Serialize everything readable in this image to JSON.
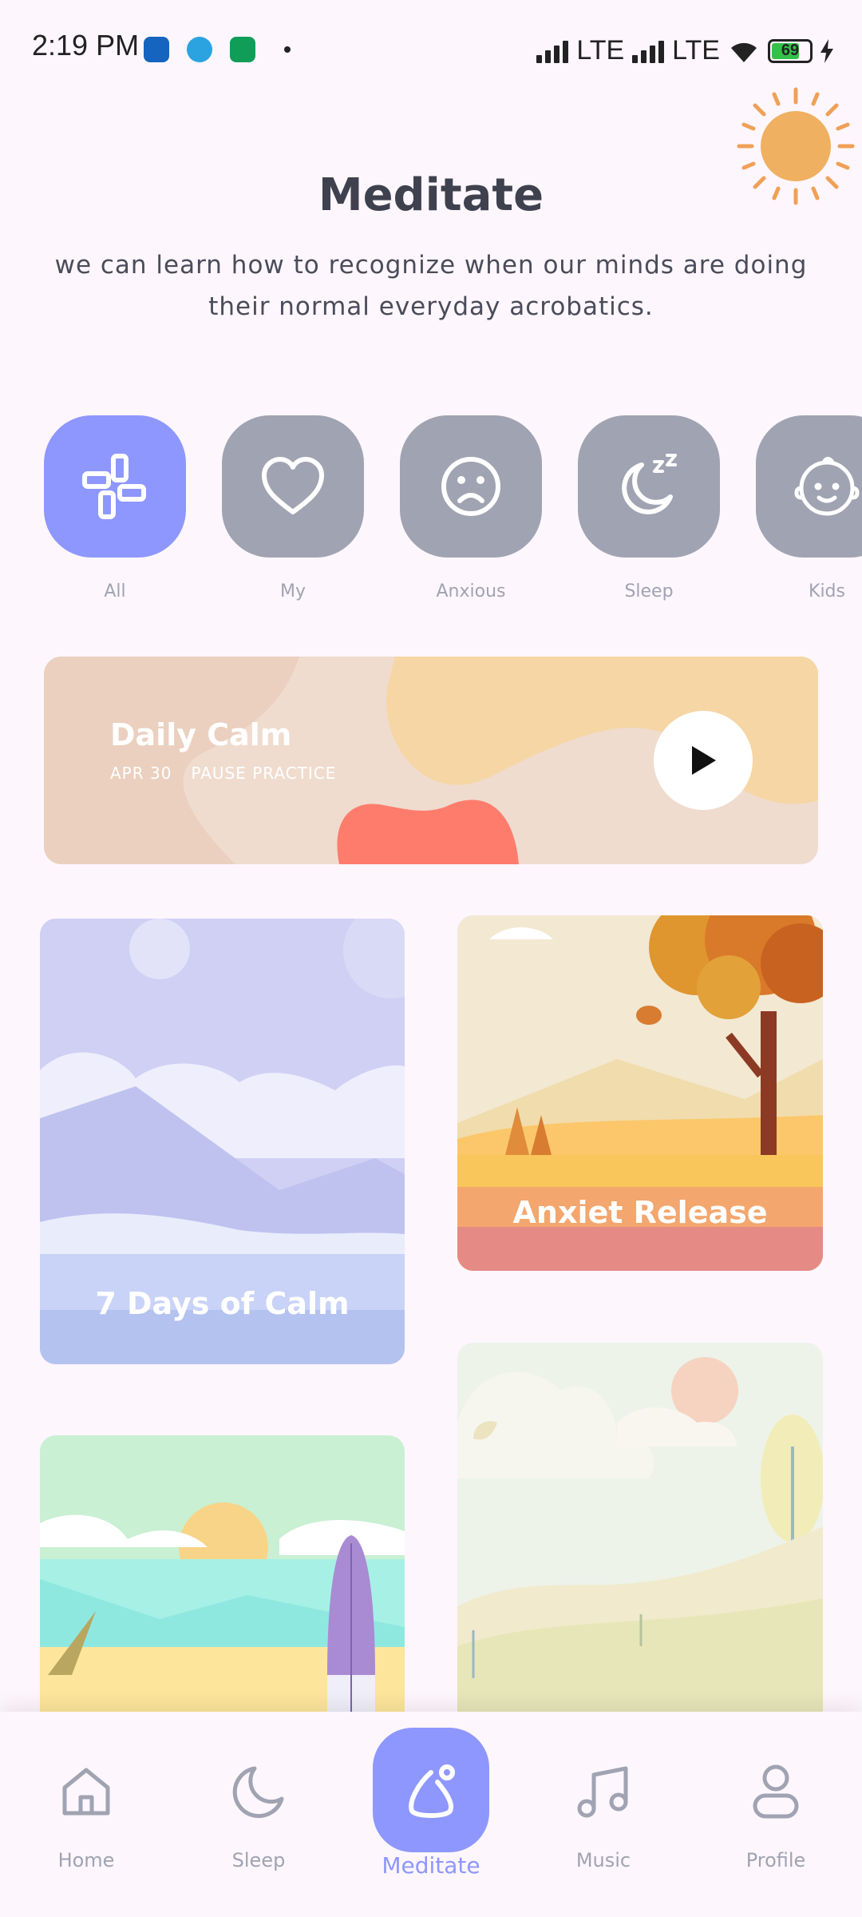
{
  "status": {
    "time": "2:19 PM",
    "network1": "LTE",
    "network2": "LTE",
    "battery": "69"
  },
  "header": {
    "title": "Meditate",
    "subtitle": "we can learn how to recognize when our minds are doing their normal everyday acrobatics."
  },
  "categories": [
    {
      "label": "All",
      "icon": "grid-icon",
      "active": true
    },
    {
      "label": "My",
      "icon": "heart-icon",
      "active": false
    },
    {
      "label": "Anxious",
      "icon": "sad-face-icon",
      "active": false
    },
    {
      "label": "Sleep",
      "icon": "moon-zzz-icon",
      "active": false
    },
    {
      "label": "Kids",
      "icon": "baby-face-icon",
      "active": false
    }
  ],
  "daily": {
    "title": "Daily Calm",
    "date": "APR 30",
    "type": "PAUSE PRACTICE"
  },
  "cards": [
    {
      "title": "7 Days of Calm"
    },
    {
      "title": "Anxiet Release"
    }
  ],
  "nav": {
    "items": [
      {
        "label": "Home",
        "icon": "home-icon"
      },
      {
        "label": "Sleep",
        "icon": "moon-icon"
      },
      {
        "label": "Meditate",
        "icon": "meditate-icon"
      },
      {
        "label": "Music",
        "icon": "music-icon"
      },
      {
        "label": "Profile",
        "icon": "profile-icon"
      }
    ],
    "active": "Meditate"
  },
  "colors": {
    "accent": "#8e97fd",
    "inactive": "#a0a3b1",
    "background": "#fdf6fc",
    "title": "#3f414e"
  }
}
